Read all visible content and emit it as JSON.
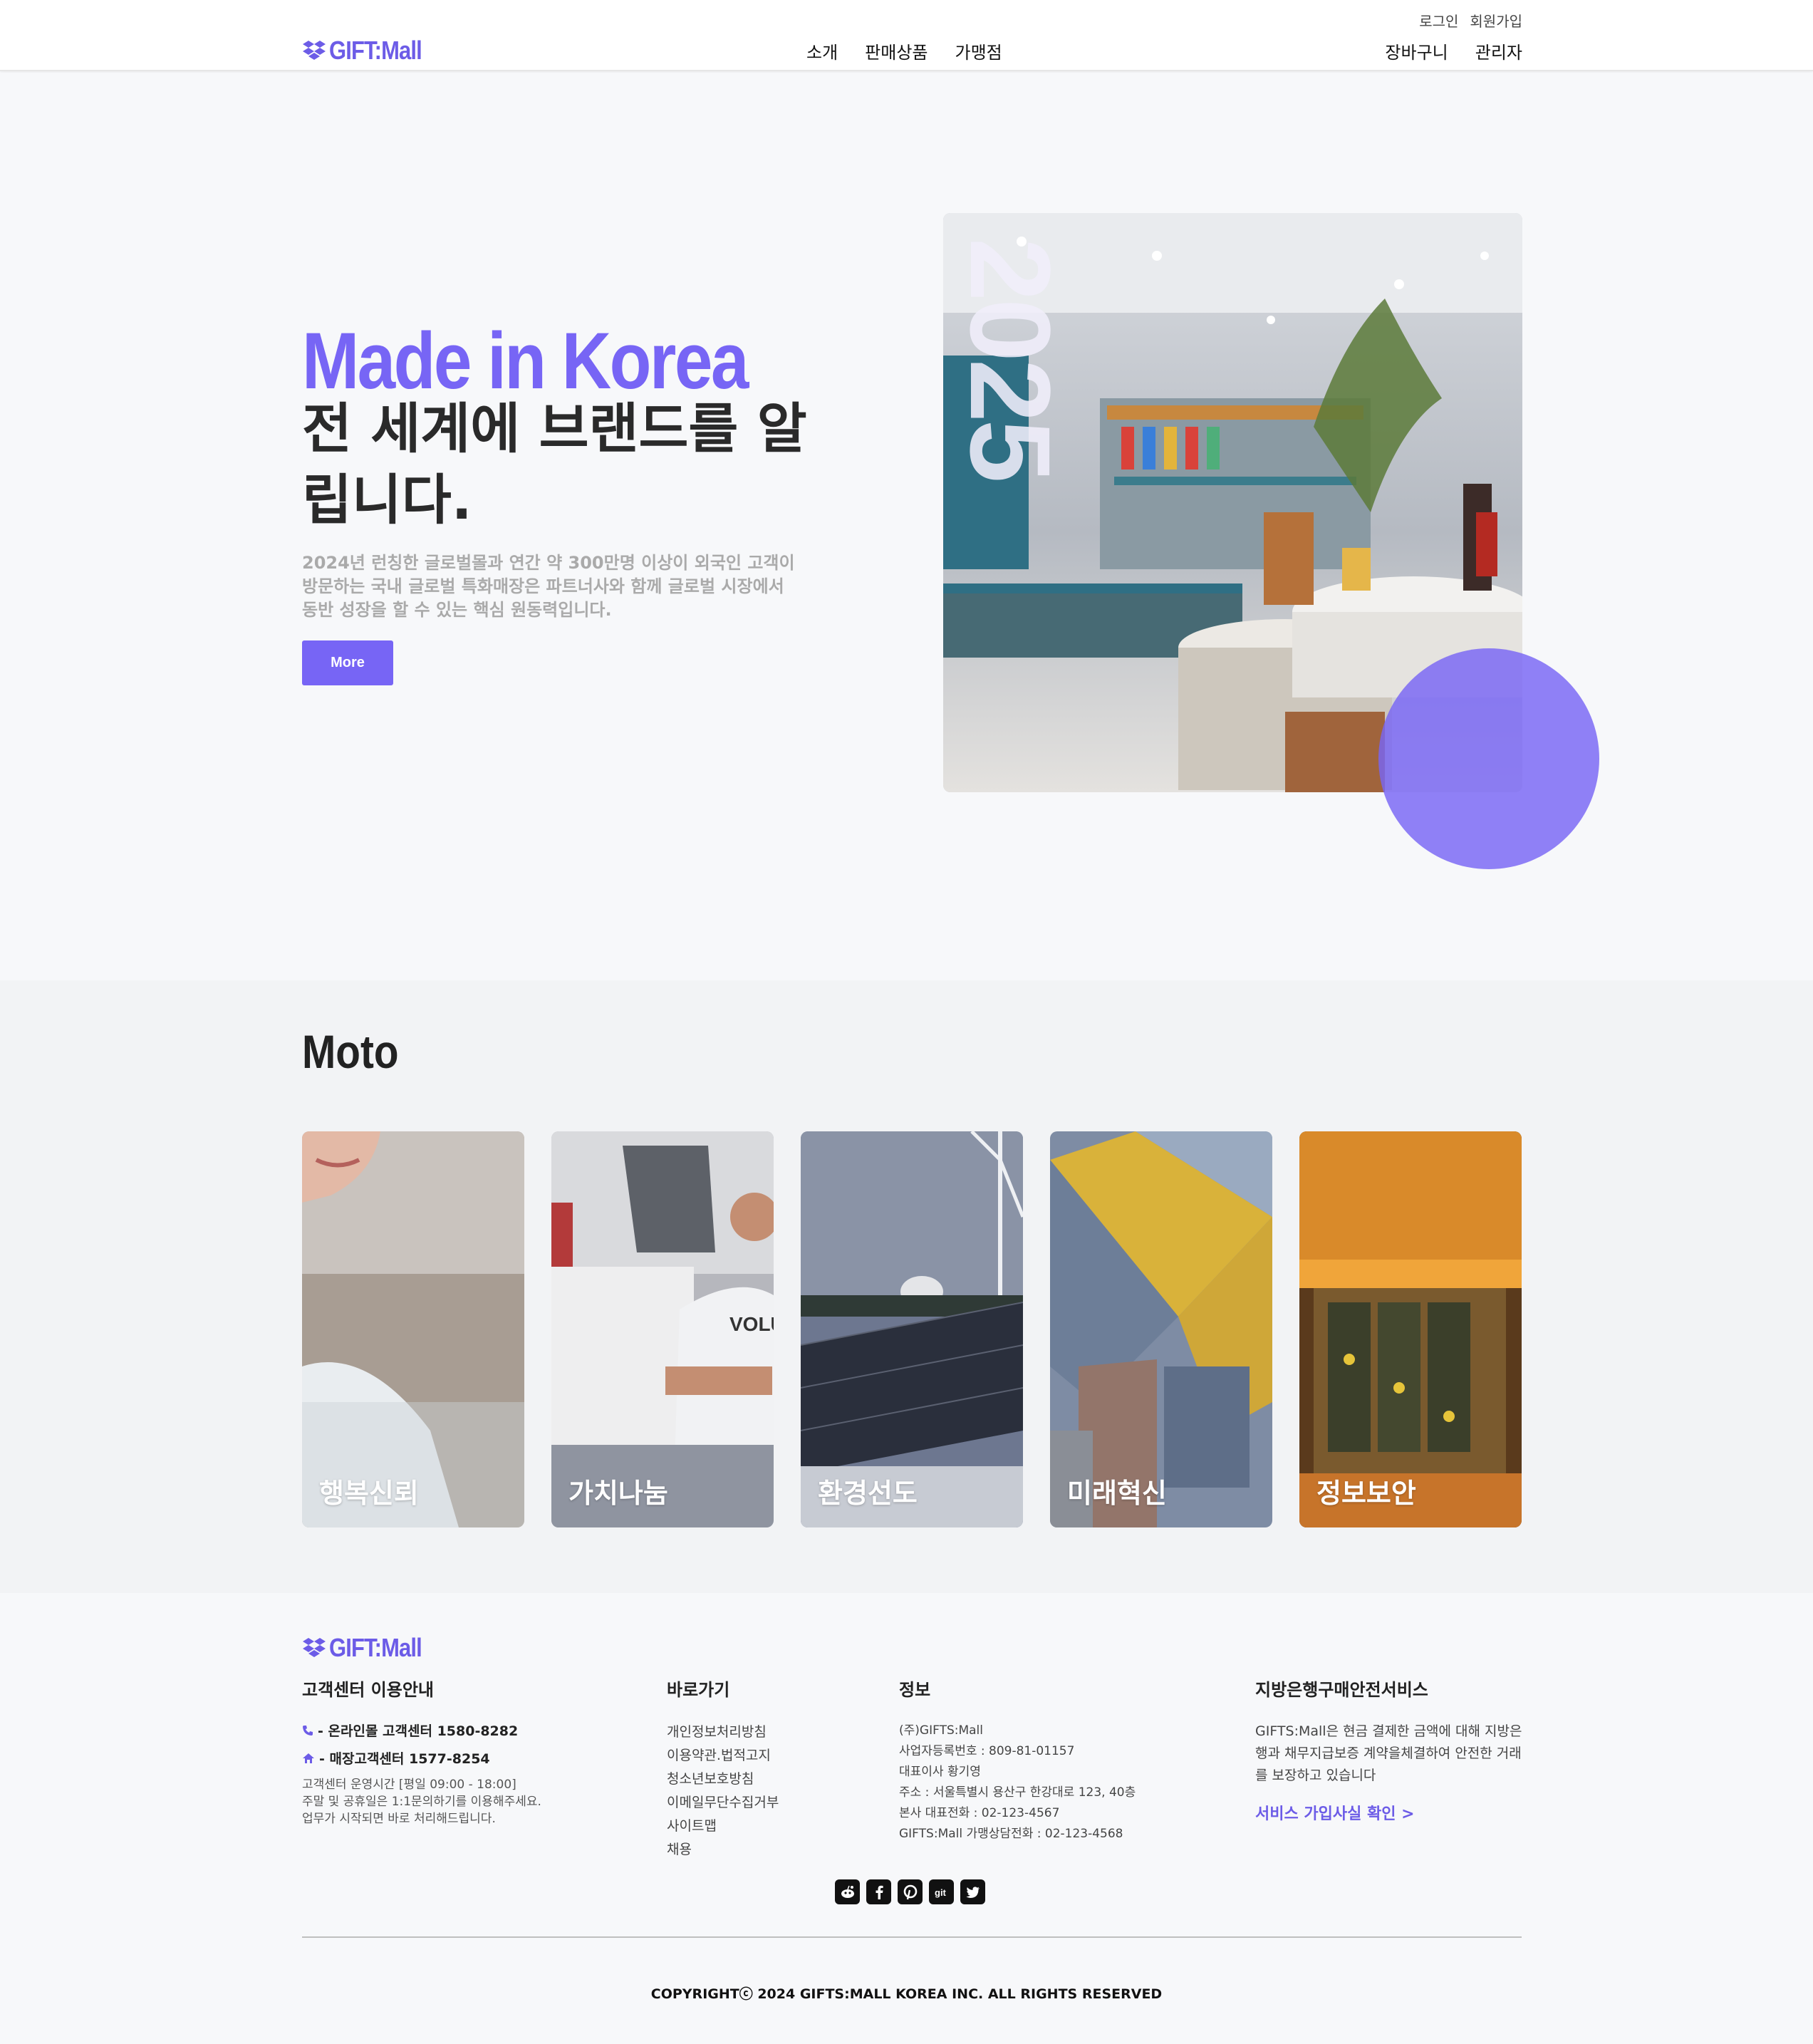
{
  "brand": {
    "logo_text": "GIFT:Mall",
    "accent_color": "#7765f5"
  },
  "header": {
    "util_links": [
      "로그인",
      "회원가입"
    ],
    "nav": [
      "소개",
      "판매상품",
      "가맹점"
    ],
    "right_nav": [
      "장바구니",
      "관리자"
    ]
  },
  "hero": {
    "title_en": "Made in Korea",
    "title_ko": "전 세계에 브랜드를 알립니다.",
    "description": "2024년 런칭한 글로벌몰과 연간 약 300만명 이상이 외국인 고객이 방문하는 국내 글로벌 특화매장은 파트너사와 함께 글로벌 시장에서 동반 성장을 할 수 있는 핵심 원동력입니다.",
    "button_label": "More",
    "year_overlay": "2025",
    "photo_icon": "store-interior-photo"
  },
  "moto": {
    "title": "Moto",
    "cards": [
      {
        "label": "행복신뢰",
        "photo": "smiling-person-photo"
      },
      {
        "label": "가치나눔",
        "photo": "volunteers-photo"
      },
      {
        "label": "환경선도",
        "photo": "solar-wind-photo"
      },
      {
        "label": "미래혁신",
        "photo": "cube-houses-photo"
      },
      {
        "label": "정보보안",
        "photo": "server-rack-photo"
      }
    ]
  },
  "footer": {
    "logo_text": "GIFT:Mall",
    "customer_center": {
      "heading": "고객센터 이용안내",
      "online": "- 온라인몰 고객센터 1580-8282",
      "store": "- 매장고객센터 1577-8254",
      "hours": "고객센터 운영시간 [평일 09:00 - 18:00]",
      "note1": "주말 및 공휴일은 1:1문의하기를 이용해주세요.",
      "note2": "업무가 시작되면 바로 처리해드립니다."
    },
    "shortcuts": {
      "heading": "바로가기",
      "links": [
        "개인정보처리방침",
        "이용약관.법적고지",
        "청소년보호방침",
        "이메일무단수집거부",
        "사이트맵",
        "채용"
      ]
    },
    "info": {
      "heading": "정보",
      "lines": [
        "(주)GIFTS:Mall",
        "사업자등록번호 : 809-81-01157",
        "대표이사 황기영",
        "주소 : 서울특별시 용산구 한강대로 123, 40층",
        "본사 대표전화 : 02-123-4567",
        "GIFTS:Mall 가맹상담전화 : 02-123-4568"
      ]
    },
    "bank_service": {
      "heading": "지방은행구매안전서비스",
      "description": "GIFTS:Mall은 현금 결제한 금액에 대해 지방은행과 채무지급보증 계약을체결하여 안전한 거래를 보장하고 있습니다",
      "link": "서비스 가입사실 확인 >"
    },
    "social_icons": [
      "reddit-icon",
      "facebook-icon",
      "pinterest-icon",
      "git-icon",
      "twitter-icon"
    ],
    "copyright": "COPYRIGHTⓒ 2024 GIFTS:MALL KOREA INC. ALL RIGHTS RESERVED"
  }
}
